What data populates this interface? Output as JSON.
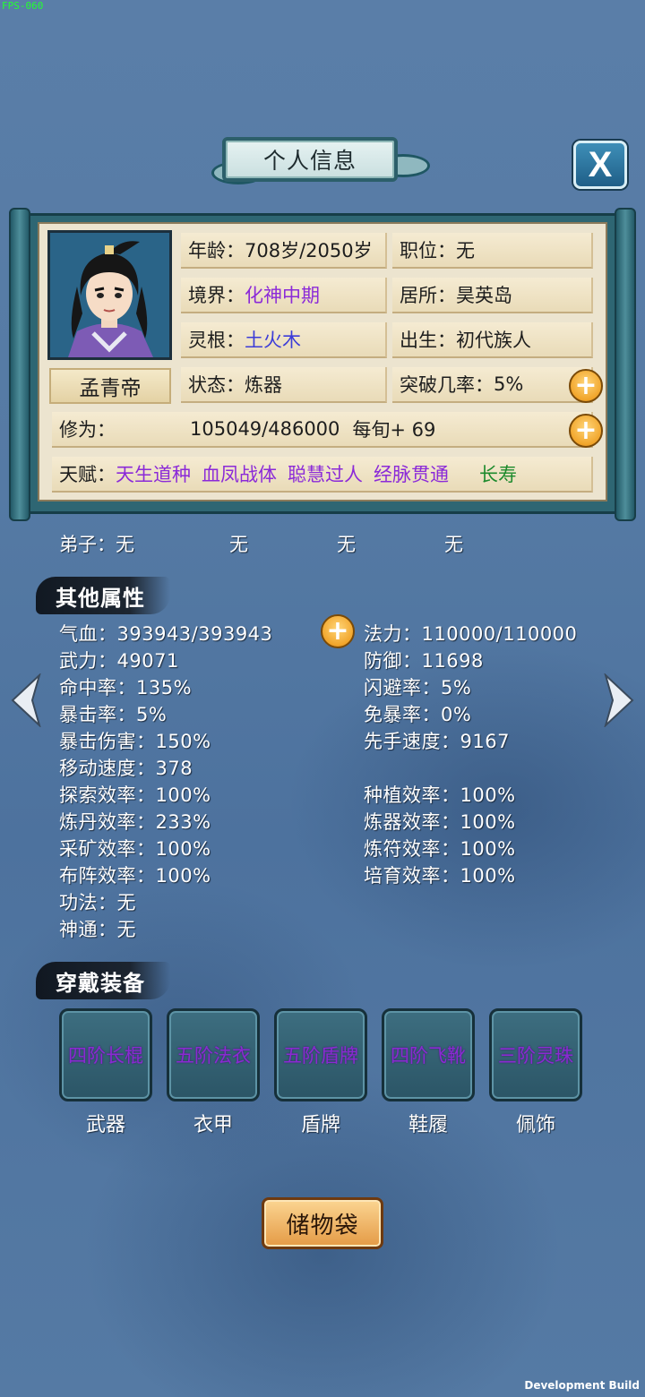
{
  "debug": {
    "fps": "FPS-060",
    "build": "Development Build"
  },
  "header": {
    "title": "个人信息",
    "close_label": "X"
  },
  "profile": {
    "name": "孟青帝",
    "age_label": "年龄：",
    "age_value": "708岁/2050岁",
    "position_label": "职位：",
    "position_value": "无",
    "realm_label": "境界：",
    "realm_value": "化神中期",
    "residence_label": "居所：",
    "residence_value": "昊英岛",
    "root_label": "灵根：",
    "root_value": "土火木",
    "birth_label": "出生：",
    "birth_value": "初代族人",
    "status_label": "状态：",
    "status_value": "炼器",
    "breakthrough_label": "突破几率：",
    "breakthrough_value": "5%",
    "cultivation_label": "修为：",
    "cultivation_value": "105049/486000",
    "cultivation_rate": "每旬+ 69",
    "talent_label": "天赋：",
    "talents": [
      "天生道种",
      "血凤战体",
      "聪慧过人",
      "经脉贯通",
      "长寿"
    ]
  },
  "disciples": {
    "label": "弟子：",
    "values": [
      "无",
      "无",
      "无",
      "无"
    ]
  },
  "other_attributes": {
    "title": "其他属性",
    "left": [
      {
        "label": "气血：",
        "value": "393943/393943"
      },
      {
        "label": "武力：",
        "value": "49071"
      },
      {
        "label": "命中率：",
        "value": "135%"
      },
      {
        "label": "暴击率：",
        "value": "5%"
      },
      {
        "label": "暴击伤害：",
        "value": "150%"
      },
      {
        "label": "移动速度：",
        "value": "378"
      },
      {
        "label": "探索效率：",
        "value": "100%"
      },
      {
        "label": "炼丹效率：",
        "value": "233%"
      },
      {
        "label": "采矿效率：",
        "value": "100%"
      },
      {
        "label": "布阵效率：",
        "value": "100%"
      },
      {
        "label": "功法：",
        "value": "无"
      },
      {
        "label": "神通：",
        "value": "无"
      }
    ],
    "right": [
      {
        "label": "法力：",
        "value": "110000/110000"
      },
      {
        "label": "防御：",
        "value": "11698"
      },
      {
        "label": "闪避率：",
        "value": "5%"
      },
      {
        "label": "免暴率：",
        "value": "0%"
      },
      {
        "label": "先手速度：",
        "value": "9167"
      },
      {
        "label": "种植效率：",
        "value": "100%"
      },
      {
        "label": "炼器效率：",
        "value": "100%"
      },
      {
        "label": "炼符效率：",
        "value": "100%"
      },
      {
        "label": "培育效率：",
        "value": "100%"
      }
    ]
  },
  "equipment": {
    "title": "穿戴装备",
    "slots": [
      {
        "item": "四阶长棍",
        "slot": "武器"
      },
      {
        "item": "五阶法衣",
        "slot": "衣甲"
      },
      {
        "item": "五阶盾牌",
        "slot": "盾牌"
      },
      {
        "item": "四阶飞靴",
        "slot": "鞋履"
      },
      {
        "item": "三阶灵珠",
        "slot": "佩饰"
      }
    ]
  },
  "storage_button": "储物袋",
  "icons": {
    "close": "close-icon",
    "plus": "plus-icon",
    "nav_left": "chevron-left-icon",
    "nav_right": "chevron-right-icon"
  },
  "colors": {
    "rare_purple": "#8b2ad8",
    "value_blue": "#3c3cd8",
    "talent_green": "#1c8a2c",
    "accent_gold": "#f1a52b"
  }
}
